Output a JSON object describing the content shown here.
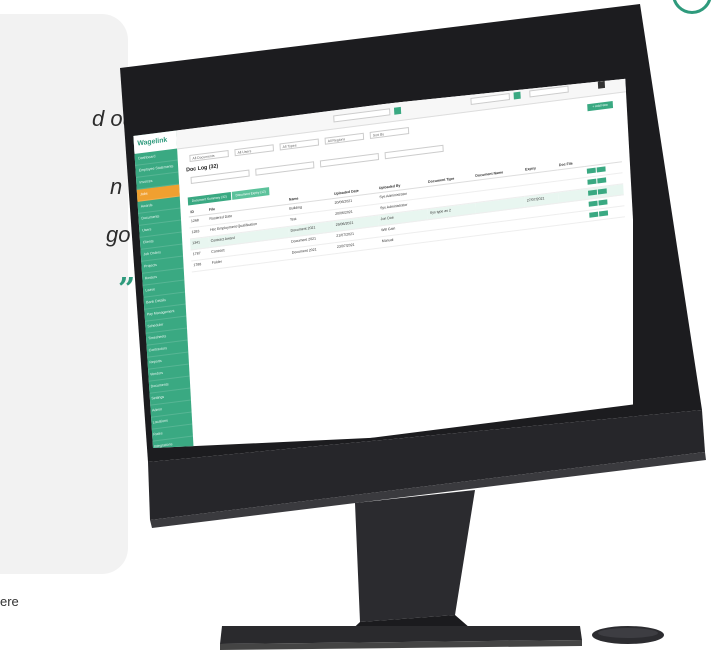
{
  "quote": {
    "lines": [
      "d out",
      "n",
      "go"
    ],
    "close_mark": "”"
  },
  "caption": "ere",
  "app": {
    "logo": "Wagelink",
    "top_search": "",
    "sidebar_items": [
      "Dashboard",
      "Employee Statements",
      "Invoices",
      "Jobs",
      "Awards",
      "Documents",
      "Users",
      "Clients",
      "Job Orders",
      "Projects",
      "Rosters",
      "Leave",
      "Bank Details",
      "Pay Management",
      "Scheduler",
      "Timesheets",
      "Contractors",
      "Reports",
      "Vendors",
      "Documents",
      "Settings",
      "Admin",
      "Locations",
      "Rates",
      "Integrations",
      "Branding",
      "Support",
      "Log out"
    ],
    "active_sidebar_index": 3,
    "filters": [
      "All Documents",
      "All Users",
      "All Types",
      "All Regions",
      "Sort By"
    ],
    "add_button": "+ Add New",
    "title": "Doc Log (32)",
    "tabs": [
      "Document Summary (32)",
      "Document Expiry (12)"
    ],
    "columns": [
      "ID",
      "File",
      "Name",
      "Uploaded Date",
      "Uploaded By",
      "Document Type",
      "Document Name",
      "Expiry",
      "Doc File"
    ],
    "rows": [
      [
        "1268",
        "Rostered Date",
        "Building",
        "20/06/2021",
        "Sys Administrator",
        "",
        "",
        "",
        ""
      ],
      [
        "1283",
        "Hsc Employment Qualification",
        "Test",
        "20/06/2021",
        "Sys Administrator",
        "",
        "",
        "",
        ""
      ],
      [
        "1341",
        "Contract Award",
        "Document 2021",
        "29/06/2021",
        "Jon Doe",
        "Sys type as 2",
        "",
        "27/07/2021",
        ""
      ],
      [
        "1787",
        "Contract",
        "Document 2021",
        "21/07/2021",
        "Will Gain",
        "",
        "",
        "",
        ""
      ],
      [
        "1788",
        "Folder",
        "Document 2021",
        "23/07/2021",
        "Manual",
        "",
        "",
        "",
        ""
      ]
    ]
  }
}
